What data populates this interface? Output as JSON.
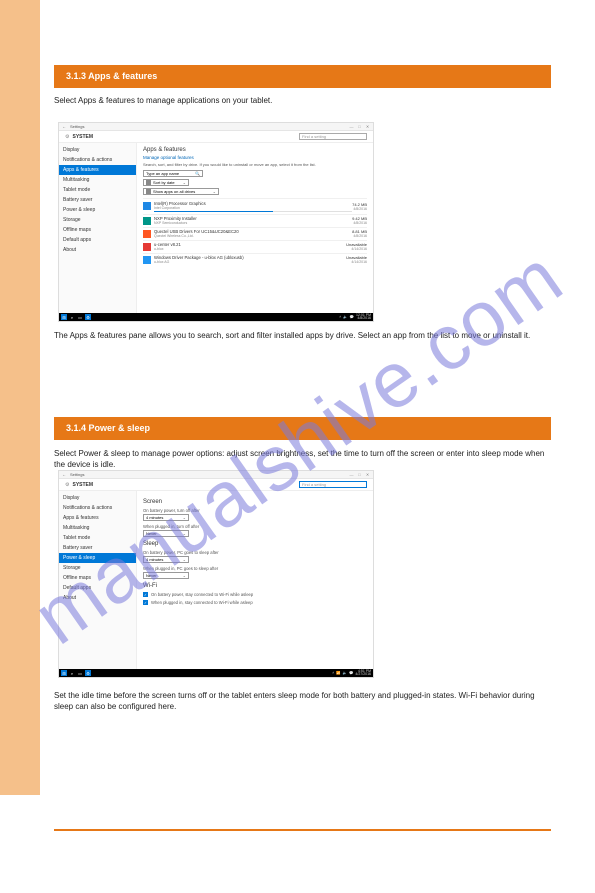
{
  "watermark": "manualshive.com",
  "sections": {
    "apps": {
      "header": "3.1.3 Apps & features",
      "description": "Select Apps & features to manage applications on your tablet."
    },
    "power": {
      "header": "3.1.4 Power & sleep",
      "description": "Select Power & sleep to manage power options: adjust screen brightness, set the time to turn off the screen or enter into sleep mode when the device is idle."
    }
  },
  "window": {
    "back_arrow": "←",
    "app_name": "Settings",
    "min": "—",
    "max": "□",
    "close": "✕",
    "system_label": "SYSTEM",
    "search_placeholder": "Find a setting"
  },
  "sidebar": [
    "Display",
    "Notifications & actions",
    "Apps & features",
    "Multitasking",
    "Tablet mode",
    "Battery saver",
    "Power & sleep",
    "Storage",
    "Offline maps",
    "Default apps",
    "About"
  ],
  "apps_page": {
    "title": "Apps & features",
    "manage_link": "Manage optional features",
    "help": "Search, sort, and filter by drive. If you would like to uninstall or move an app, select it from the list.",
    "search_ph": "Type an app name",
    "sort_label": "Sort by date",
    "drives_label": "Show apps on all drives",
    "apps": [
      {
        "name": "Intel(R) Processor Graphics",
        "publisher": "Intel Corporation",
        "size": "74.2 MB",
        "date": "4/8/2016",
        "icon": "ic-blue",
        "progress": true
      },
      {
        "name": "NXP Proximity Installer",
        "publisher": "NXP Semiconductors",
        "size": "9.42 MB",
        "date": "4/8/2016",
        "icon": "ic-teal"
      },
      {
        "name": "Quectel USB Drivers For UC15&UC20&EC20",
        "publisher": "Quectel Wireless Co.,Ltd.",
        "size": "8.81 MB",
        "date": "4/8/2016",
        "icon": "ic-orange"
      },
      {
        "name": "u-center v8.21",
        "publisher": "u-blox",
        "size": "Unavailable",
        "date": "4/14/2016",
        "icon": "ic-red"
      },
      {
        "name": "Windows Driver Package - u-blox AG (ubloxusb)",
        "publisher": "u-blox AG",
        "size": "Unavailable",
        "date": "4/14/2016",
        "icon": "ic-bluew"
      }
    ]
  },
  "power_page": {
    "screen_title": "Screen",
    "battery_screen_label": "On battery power, turn off after",
    "battery_screen_value": "4 minutes",
    "plugged_screen_label": "When plugged in, turn off after",
    "plugged_screen_value": "Never",
    "sleep_title": "Sleep",
    "battery_sleep_label": "On battery power, PC goes to sleep after",
    "battery_sleep_value": "4 minutes",
    "plugged_sleep_label": "When plugged in, PC goes to sleep after",
    "plugged_sleep_value": "Never",
    "wifi_title": "Wi-Fi",
    "wifi_check1": "On battery power, stay connected to Wi-Fi while asleep",
    "wifi_check2": "When plugged in, stay connected to Wi-Fi while asleep"
  },
  "taskbar": {
    "time1": "12:01 PM",
    "date1": "4/8/2016",
    "time2": "4:51 PM",
    "date2": "4/27/2016"
  },
  "under": {
    "apps": "The Apps & features pane allows you to search, sort and filter installed apps by drive. Select an app from the list to move or uninstall it.",
    "power": "Set the idle time before the screen turns off or the tablet enters sleep mode for both battery and plugged-in states. Wi-Fi behavior during sleep can also be configured here."
  }
}
